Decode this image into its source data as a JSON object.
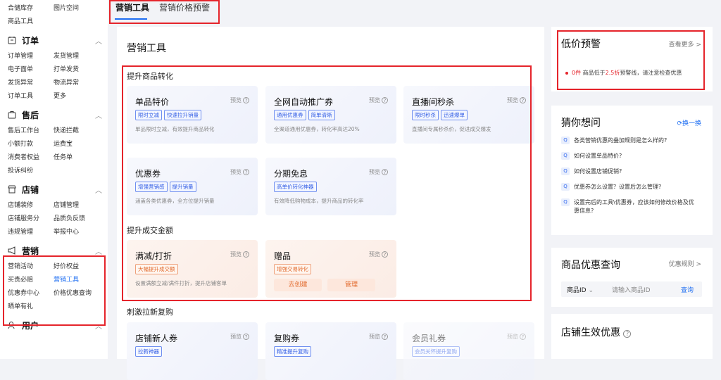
{
  "sidebar": {
    "top_rows": [
      [
        "合储库存",
        "图片空间"
      ],
      [
        "商品工具",
        ""
      ]
    ],
    "groups": [
      {
        "title": "订单",
        "icon": "order-icon",
        "rows": [
          [
            "订单管理",
            "发货管理"
          ],
          [
            "电子面单",
            "打单发货"
          ],
          [
            "发货异常",
            "物流异常"
          ],
          [
            "订单工具",
            "更多"
          ]
        ]
      },
      {
        "title": "售后",
        "icon": "aftersale-icon",
        "rows": [
          [
            "售后工作台",
            "快递拦截"
          ],
          [
            "小额打款",
            "运费宝"
          ],
          [
            "消费者权益",
            "任务单"
          ],
          [
            "投诉纠纷",
            ""
          ]
        ]
      },
      {
        "title": "店铺",
        "icon": "shop-icon",
        "rows": [
          [
            "店铺装修",
            "店铺管理"
          ],
          [
            "店铺服务分",
            "品质负反馈"
          ],
          [
            "违规管理",
            "举报中心"
          ]
        ]
      },
      {
        "title": "营销",
        "icon": "megaphone-icon",
        "rows": [
          [
            "营销活动",
            "好价权益"
          ],
          [
            "买贵必赔",
            "营销工具"
          ],
          [
            "优惠券中心",
            "价格优惠查询"
          ],
          [
            "晒单有礼",
            ""
          ]
        ]
      },
      {
        "title": "用户",
        "icon": "user-icon",
        "rows": []
      }
    ]
  },
  "tabs": [
    "营销工具",
    "营销价格预警"
  ],
  "main": {
    "title": "营销工具",
    "sections": [
      "提升商品转化",
      "提升成交金额",
      "刺激拉新复购"
    ],
    "preview": "预览",
    "cards": [
      {
        "title": "单品特价",
        "tags": [
          "限时立减",
          "快速拉升销量"
        ],
        "desc": "单品限时立减，有效提升商品转化"
      },
      {
        "title": "全网自动推广券",
        "tags": [
          "通用优惠券",
          "简单清晰"
        ],
        "desc": "全渠道通用优惠券，转化率高达20%"
      },
      {
        "title": "直播间秒杀",
        "tags": [
          "限时秒杀",
          "迅速爆单"
        ],
        "desc": "直播间专属秒杀价，促进成交爆发"
      },
      {
        "title": "优惠券",
        "tags": [
          "增强营销感",
          "提升销量"
        ],
        "desc": "涵盖各类优惠券，全方位提升销量"
      },
      {
        "title": "分期免息",
        "tags": [
          "高单价转化神器"
        ],
        "desc": "有效降低购物成本，提升商品的转化率"
      },
      {
        "title": "满减/打折",
        "tags": [
          "大幅提升成交额"
        ],
        "desc": "设置满额立减/满件打折，提升店铺客单"
      },
      {
        "title": "赠品",
        "tags": [
          "增强交易转化"
        ],
        "desc": "",
        "buttons": [
          "去创建",
          "管理"
        ]
      },
      {
        "title": "店铺新人券",
        "tags": [
          "拉新神器"
        ],
        "desc": ""
      },
      {
        "title": "复购券",
        "tags": [
          "精准提升复购"
        ],
        "desc": ""
      },
      {
        "title": "会员礼券",
        "tags": [
          "会员关怀提升复购"
        ],
        "desc": ""
      }
    ]
  },
  "alert": {
    "title": "低价预警",
    "more": "查看更多 >",
    "count": "0件",
    "mid": "商品低于",
    "rate": "2.5折",
    "tail": "预警线，请注意检查优惠"
  },
  "faq": {
    "title": "猜你想问",
    "refresh": "换一换",
    "badge": "Q",
    "items": [
      "各类营销优惠的叠加规则是怎么样的?",
      "如何设置单品特价?",
      "如何设置店铺促销?",
      "优惠券怎么设置？设置后怎么管理?",
      "设置完后的工具\\优惠券，应该如何修改价格及优惠信息?"
    ]
  },
  "query": {
    "title": "商品优惠查询",
    "rules": "优惠规则 >",
    "select": "商品ID",
    "placeholder": "请输入商品ID",
    "button": "查询"
  },
  "effective": {
    "title": "店铺生效优惠"
  }
}
